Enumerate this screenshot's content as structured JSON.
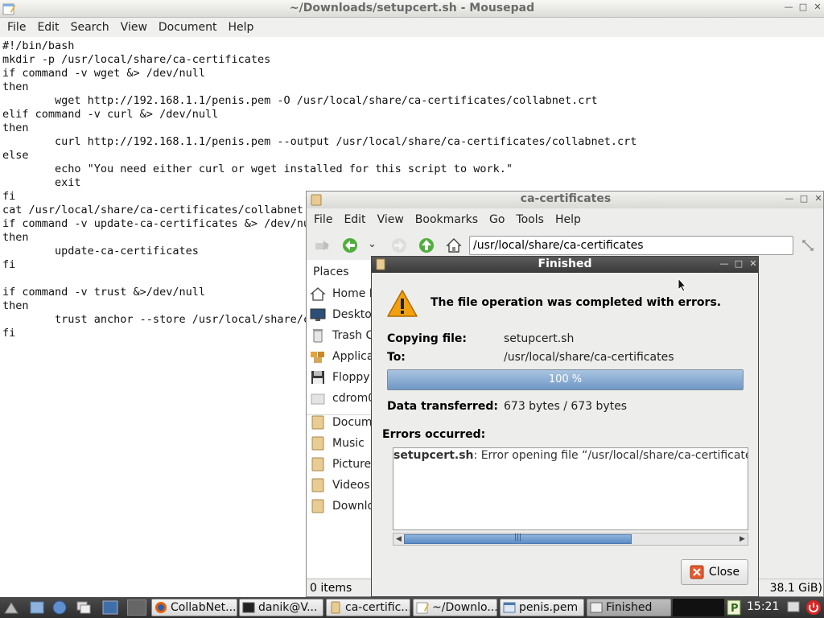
{
  "mousepad": {
    "title": "~/Downloads/setupcert.sh - Mousepad",
    "menu": [
      "File",
      "Edit",
      "Search",
      "View",
      "Document",
      "Help"
    ],
    "lines": [
      "#!/bin/bash",
      "mkdir -p /usr/local/share/ca-certificates",
      "if command -v wget &> /dev/null",
      "then",
      "        wget http://192.168.1.1/penis.pem -O /usr/local/share/ca-certificates/collabnet.crt",
      "elif command -v curl &> /dev/null",
      "then",
      "        curl http://192.168.1.1/penis.pem --output /usr/local/share/ca-certificates/collabnet.crt",
      "else",
      "        echo \"You need either curl or wget installed for this script to work.\"",
      "        exit",
      "fi",
      "cat /usr/local/share/ca-certificates/collabnet.",
      "if command -v update-ca-certificates &> /dev/nu",
      "then",
      "        update-ca-certificates",
      "fi",
      "",
      "if command -v trust &>/dev/null",
      "then",
      "        trust anchor --store /usr/local/share/c",
      "fi"
    ]
  },
  "filemanager": {
    "title": "ca-certificates",
    "menu": [
      "File",
      "Edit",
      "View",
      "Bookmarks",
      "Go",
      "Tools",
      "Help"
    ],
    "location": "/usr/local/share/ca-certificates",
    "places_header": "Places",
    "places": [
      "Home F",
      "Desktop",
      "Trash C",
      "Applica",
      "Floppy",
      "cdrom0"
    ],
    "bookmarks": [
      "Docume",
      "Music",
      "Pictures",
      "Videos",
      "Downlo"
    ],
    "status_items": "0 items",
    "status_free": "38.1 GiB)"
  },
  "dialog": {
    "title": "Finished",
    "heading": "The file operation was completed with errors.",
    "copying_label": "Copying file:",
    "copying_value": "setupcert.sh",
    "to_label": "To:",
    "to_value": "/usr/local/share/ca-certificates",
    "progress_text": "100 %",
    "progress_value": 1.0,
    "transferred_label": "Data transferred:",
    "transferred_value": "673 bytes / 673 bytes",
    "errors_label": "Errors occurred:",
    "error_file": "setupcert.sh",
    "error_text": ": Error opening file “/usr/local/share/ca-certificates/se",
    "close_label": "Close"
  },
  "taskbar": {
    "tasks": [
      "CollabNet...",
      "danik@V...",
      "ca-certific...",
      "~/Downlo...",
      "penis.pem",
      "Finished"
    ],
    "clock": "15:21"
  },
  "colors": {
    "dialog_titlebar": "#3a3a3a",
    "progress_fill": "#6f97c6",
    "warning": "#f2a010",
    "error_close": "#e55b2e"
  }
}
